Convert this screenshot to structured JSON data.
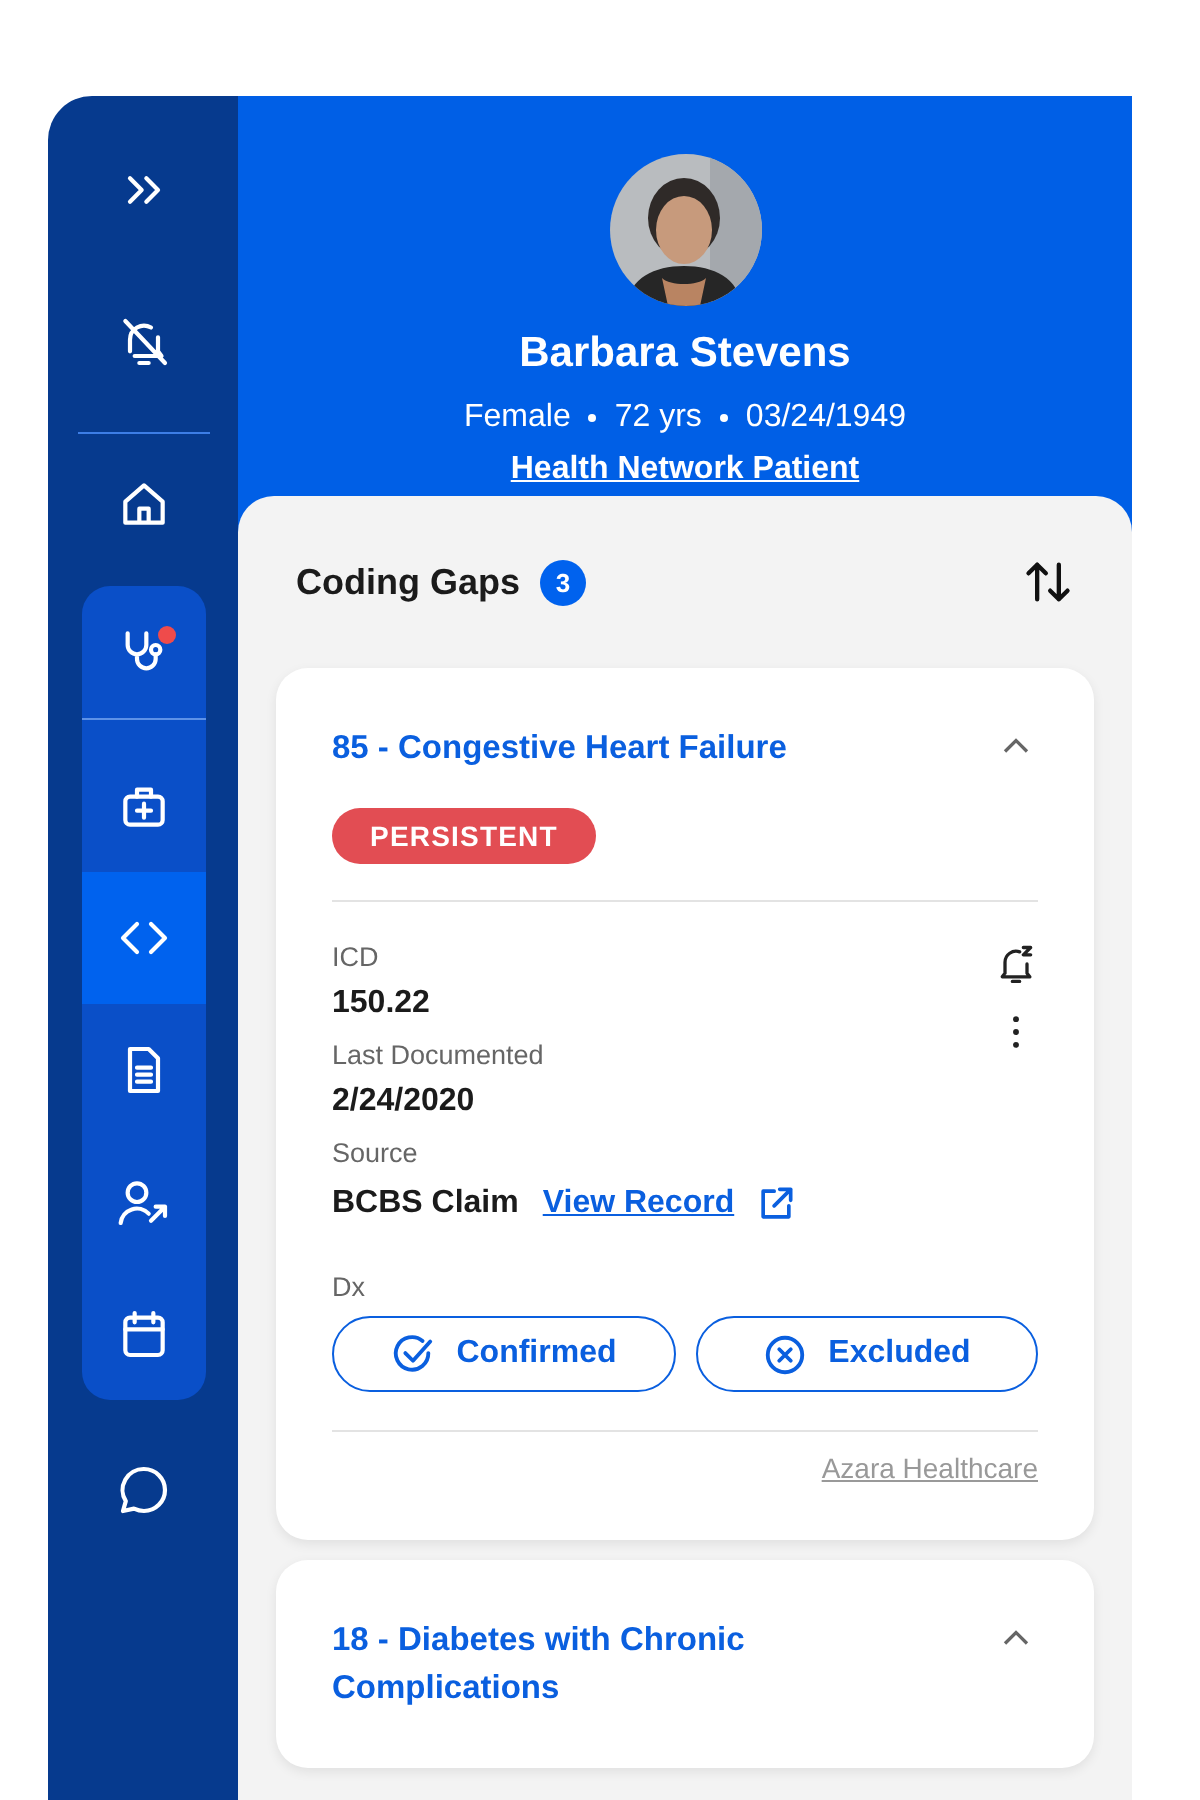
{
  "sidebar": {
    "top": [
      {
        "kind": "expand"
      },
      {
        "kind": "notifications_off"
      },
      {
        "kind": "home"
      }
    ],
    "group": [
      {
        "kind": "stethoscope",
        "selected": false,
        "alert": true
      },
      {
        "kind": "medkit",
        "selected": false,
        "alert": false
      },
      {
        "kind": "code",
        "selected": true,
        "alert": false
      },
      {
        "kind": "document",
        "selected": false,
        "alert": false
      },
      {
        "kind": "referral",
        "selected": false,
        "alert": false
      },
      {
        "kind": "calendar",
        "selected": false,
        "alert": false
      }
    ],
    "bottom": [
      {
        "kind": "chat"
      }
    ]
  },
  "patient": {
    "name": "Barbara Stevens",
    "info": [
      "Female",
      "72 yrs",
      "03/24/1949"
    ],
    "link": "Health Network Patient"
  },
  "coding_gaps": {
    "title": "Coding Gaps",
    "count": "3",
    "cards": [
      {
        "title": "85 - Congestive Heart Failure",
        "expanded": true,
        "tag": {
          "label": "PERSISTENT",
          "kind": "persistent"
        },
        "fields": [
          {
            "label": "ICD",
            "value": "150.22"
          },
          {
            "label": "Last Documented",
            "value": "2/24/2020"
          },
          {
            "label": "Source",
            "value": "BCBS Claim",
            "link": "View Record"
          }
        ],
        "dx_label": "Dx",
        "actions": [
          {
            "label": "Confirmed",
            "kind": "confirm"
          },
          {
            "label": "Excluded",
            "kind": "exclude"
          }
        ],
        "footer_link": "Azara Healthcare"
      },
      {
        "title": "18 - Diabetes with Chronic Complications",
        "expanded": true
      }
    ]
  }
}
